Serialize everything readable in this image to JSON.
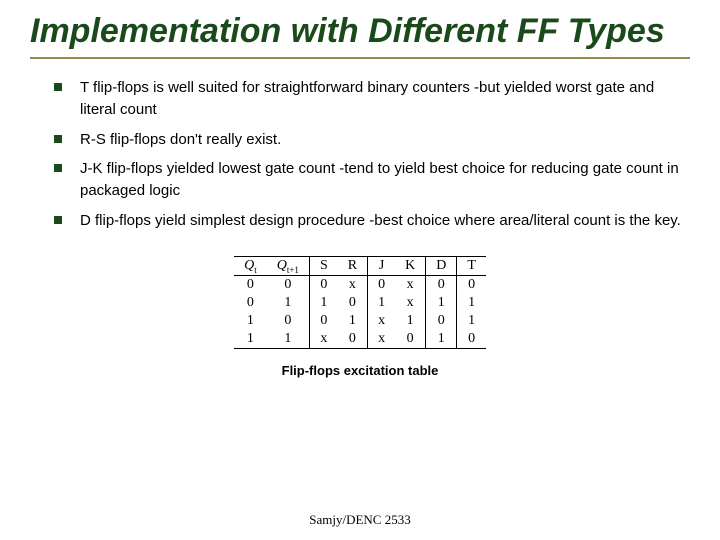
{
  "title": "Implementation with Different FF Types",
  "bullets": [
    "T flip-flops is well suited for straightforward binary counters -but yielded worst gate and literal count",
    "R-S flip-flops don't really exist.",
    "J-K flip-flops yielded lowest gate count -tend to yield best choice for reducing gate count in packaged logic",
    "D flip-flops yield simplest design procedure -best choice where area/literal count is the key."
  ],
  "caption": "Flip-flops excitation table",
  "footer": "Samjy/DENC 2533",
  "chart_data": {
    "type": "table",
    "title": "Flip-flops excitation table",
    "columns": [
      "Qt",
      "Qt+1",
      "S",
      "R",
      "J",
      "K",
      "D",
      "T"
    ],
    "rows": [
      [
        "0",
        "0",
        "0",
        "x",
        "0",
        "x",
        "0",
        "0"
      ],
      [
        "0",
        "1",
        "1",
        "0",
        "1",
        "x",
        "1",
        "1"
      ],
      [
        "1",
        "0",
        "0",
        "1",
        "x",
        "1",
        "0",
        "1"
      ],
      [
        "1",
        "1",
        "x",
        "0",
        "x",
        "0",
        "1",
        "0"
      ]
    ]
  }
}
